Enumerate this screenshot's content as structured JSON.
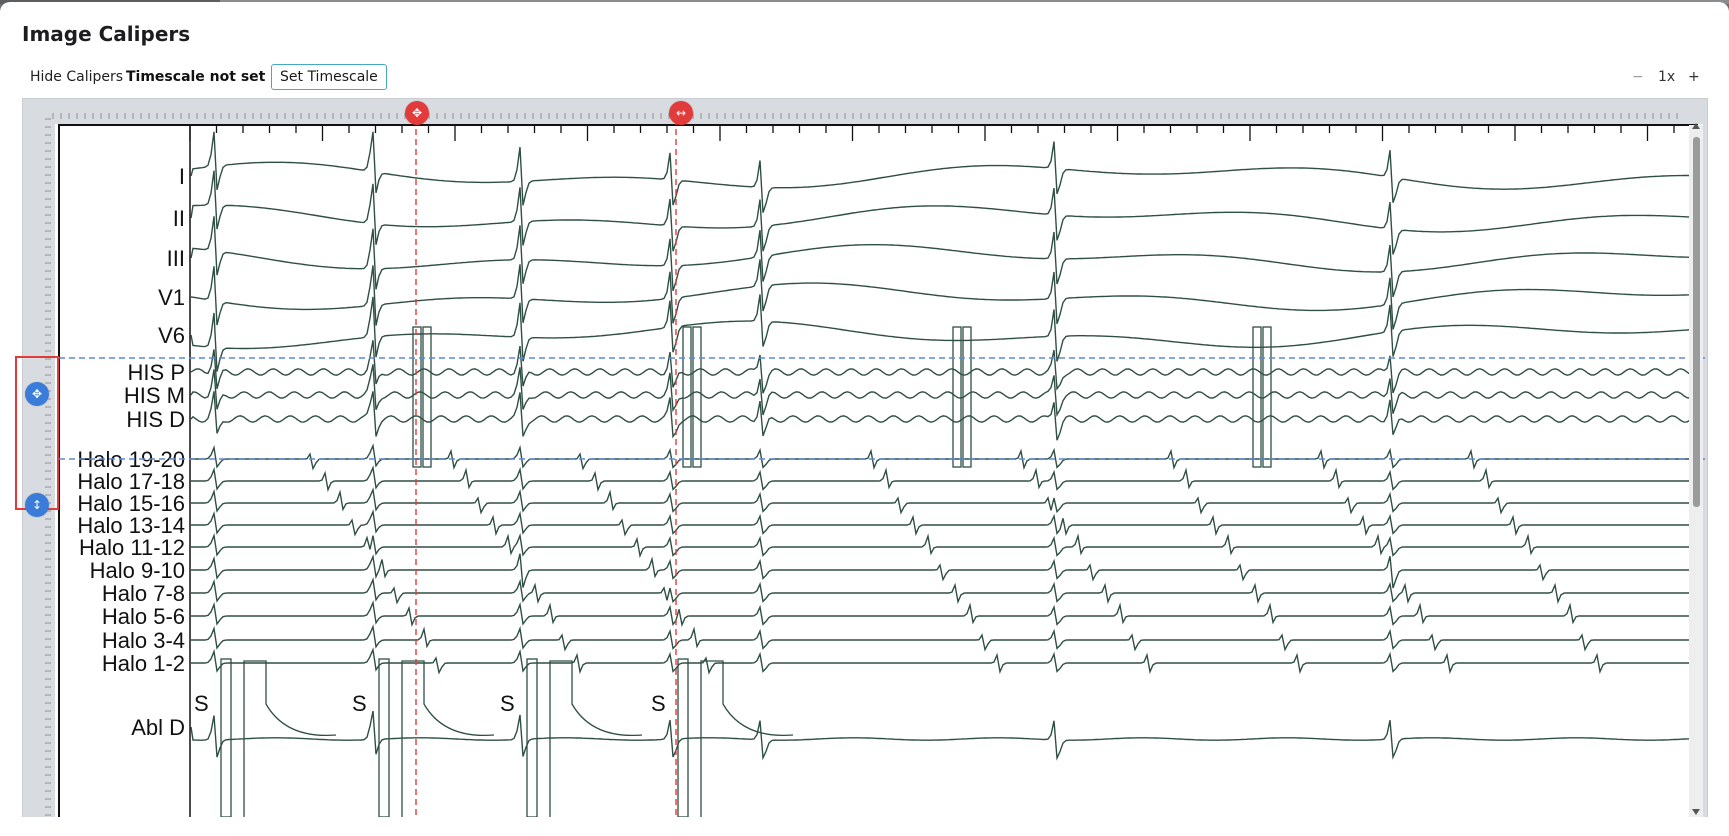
{
  "dialog": {
    "title": "Image Calipers"
  },
  "toolbar": {
    "hide_calipers": "Hide Calipers",
    "timescale_status": "Timescale not set",
    "set_timescale": "Set Timescale",
    "zoom_minus": "−",
    "zoom_level": "1x",
    "zoom_plus": "+"
  },
  "tracing": {
    "leads": [
      "I",
      "II",
      "III",
      "V1",
      "V6",
      "HIS P",
      "HIS M",
      "HIS D",
      "Halo 19-20",
      "Halo 17-18",
      "Halo 15-16",
      "Halo 13-14",
      "Halo 11-12",
      "Halo 9-10",
      "Halo 7-8",
      "Halo 5-6",
      "Halo 3-4",
      "Halo 1-2",
      "Abl D"
    ],
    "stim_marker": "S"
  },
  "calipers": {
    "vertical_color": "#e03b3b",
    "horizontal_color": "#5b8ad9",
    "handle_icons": [
      "move-icon",
      "resize-horizontal-icon",
      "move-icon",
      "resize-vertical-icon"
    ]
  },
  "colors": {
    "accent_button": "#47a8c3",
    "trace": "#2f4f45",
    "selection_box": "#e03b3b"
  }
}
